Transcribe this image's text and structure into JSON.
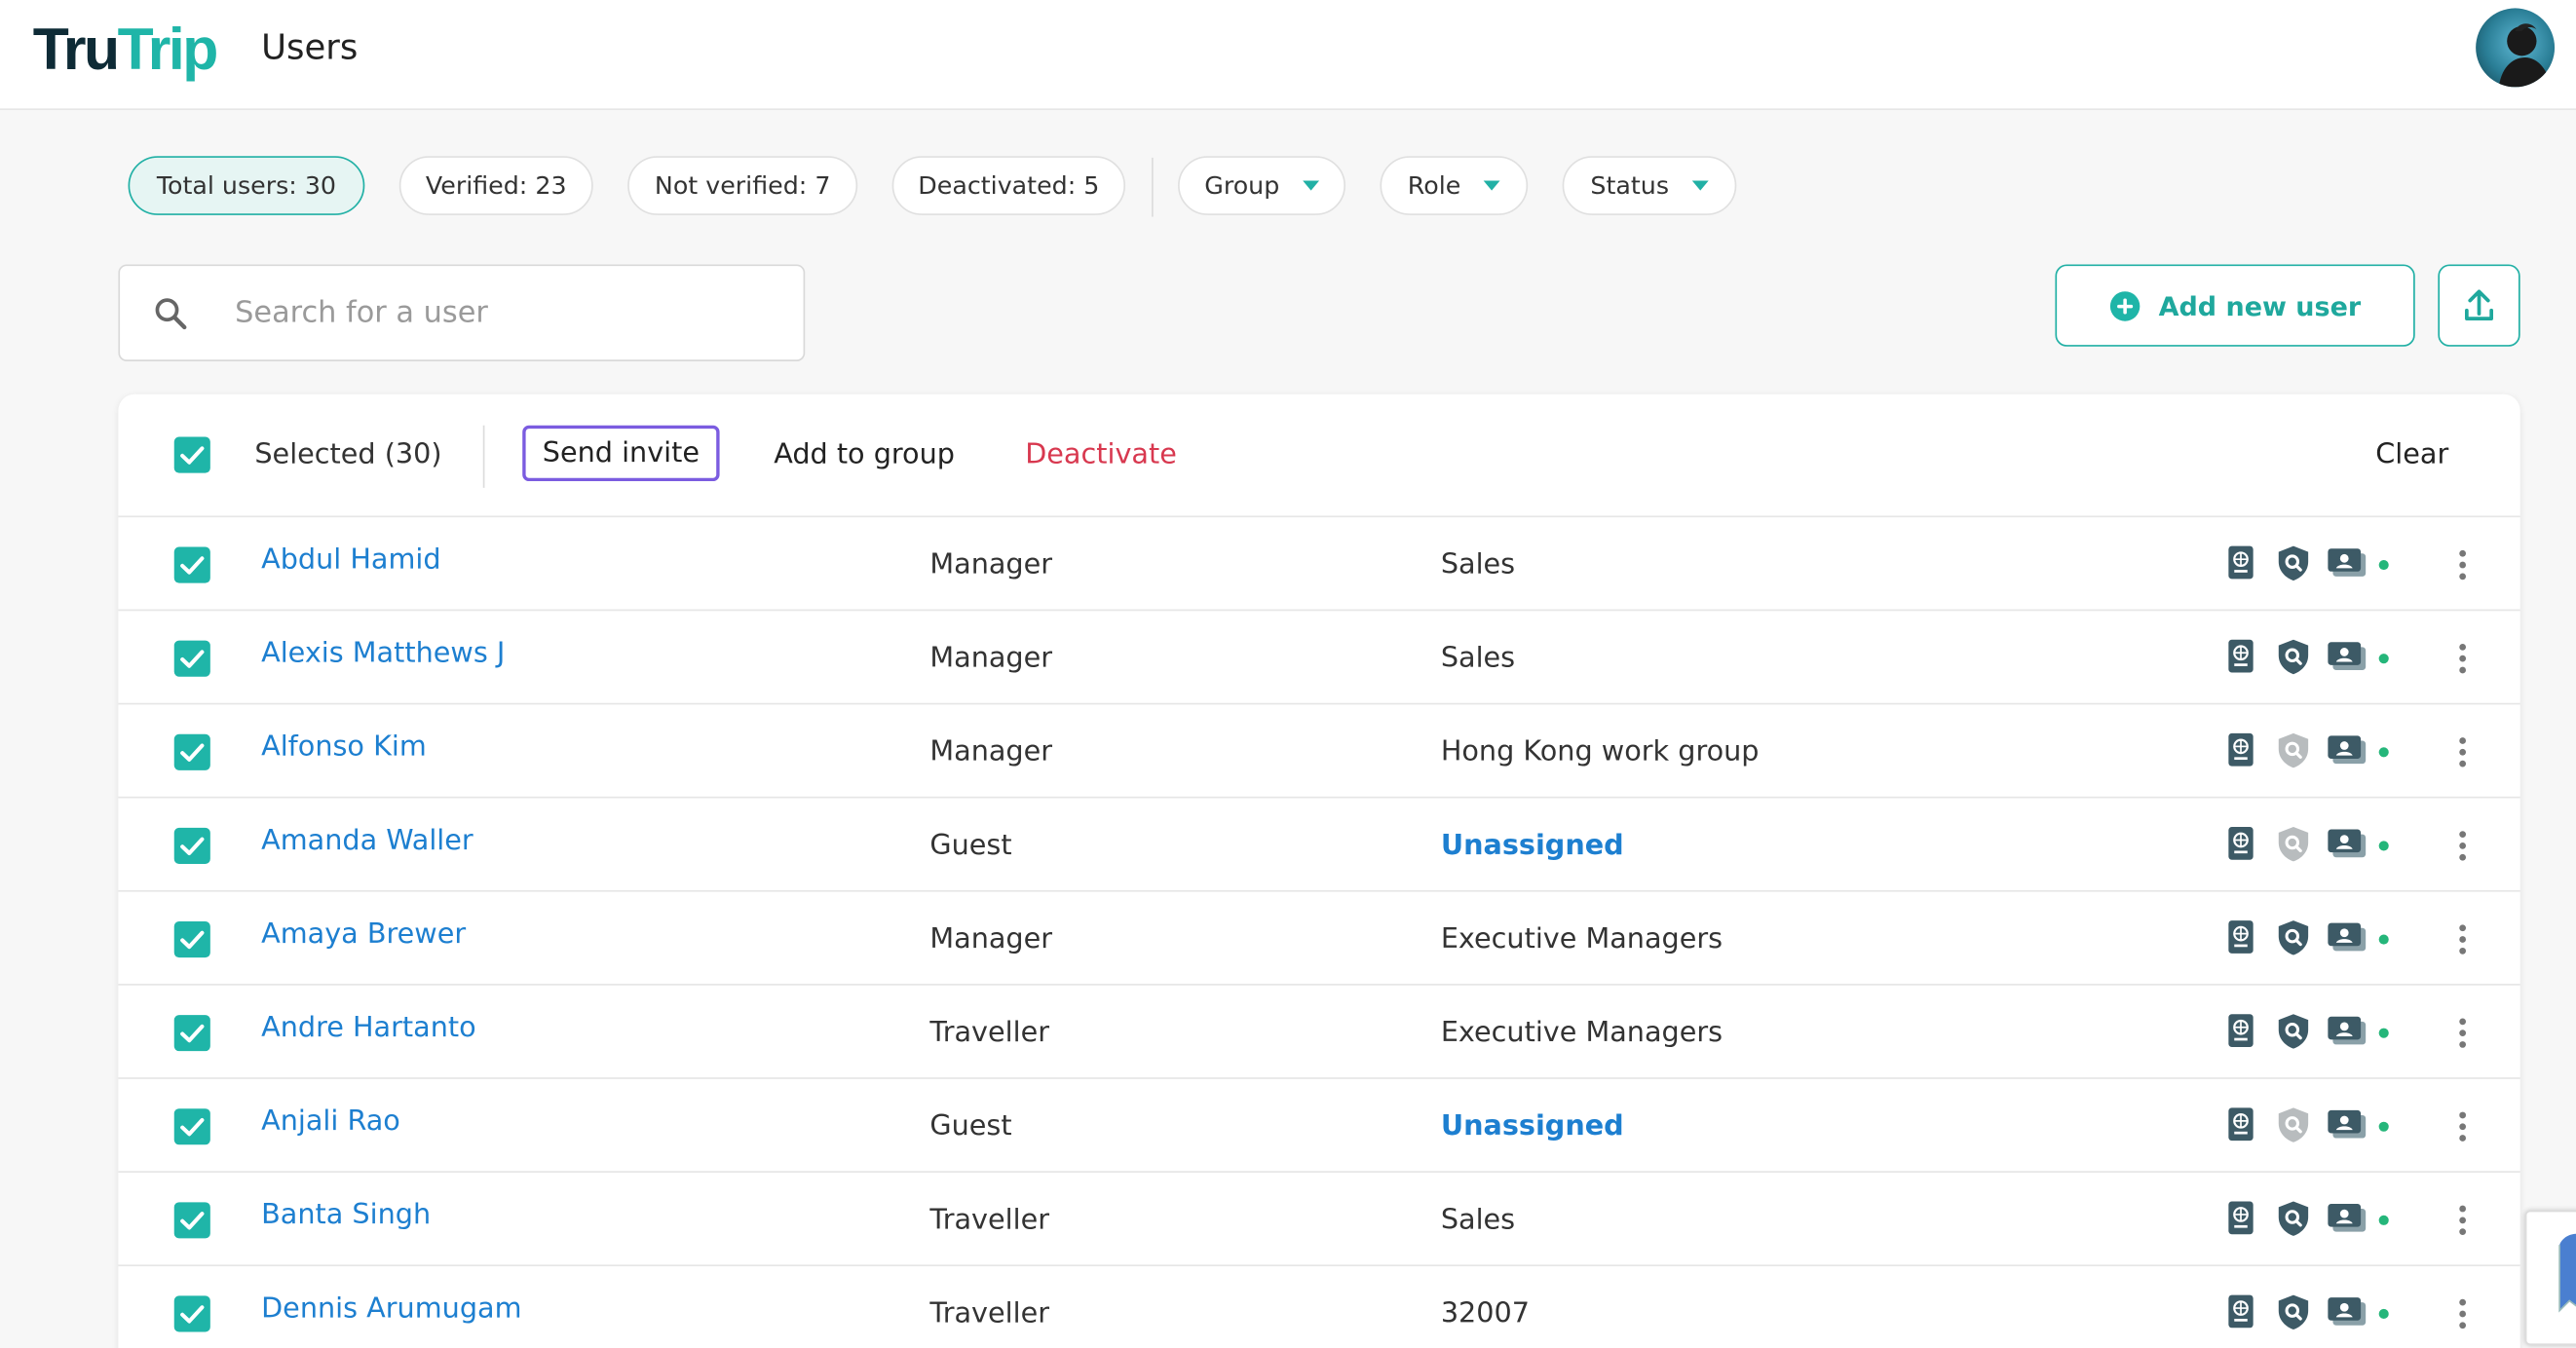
{
  "app": {
    "logo_part1": "Tru",
    "logo_part2": "Trip",
    "page_title": "Users",
    "accent_color": "#1fb5a8",
    "link_color": "#1d7fd0",
    "danger_color": "#d8384f",
    "focus_color": "#7b5ce0"
  },
  "filters": {
    "total": "Total users: 30",
    "verified": "Verified: 23",
    "not_verified": "Not verified: 7",
    "deactivated": "Deactivated: 5",
    "group": "Group",
    "role": "Role",
    "status": "Status"
  },
  "search": {
    "placeholder": "Search for a user",
    "value": ""
  },
  "actions": {
    "add_user": "Add new user"
  },
  "bulk": {
    "selected": "Selected (30)",
    "send_invite": "Send invite",
    "add_to_group": "Add to group",
    "deactivate": "Deactivate",
    "clear": "Clear"
  },
  "users": [
    {
      "name": "Abdul Hamid",
      "role": "Manager",
      "group": "Sales"
    },
    {
      "name": "Alexis Matthews J",
      "role": "Manager",
      "group": "Sales"
    },
    {
      "name": "Alfonso Kim",
      "role": "Manager",
      "group": "Hong Kong work group"
    },
    {
      "name": "Amanda Waller",
      "role": "Guest",
      "group": "Unassigned"
    },
    {
      "name": "Amaya Brewer",
      "role": "Manager",
      "group": "Executive Managers"
    },
    {
      "name": "Andre Hartanto",
      "role": "Traveller",
      "group": "Executive Managers"
    },
    {
      "name": "Anjali Rao",
      "role": "Guest",
      "group": "Unassigned"
    },
    {
      "name": "Banta Singh",
      "role": "Traveller",
      "group": "Sales"
    },
    {
      "name": "Dennis Arumugam",
      "role": "Traveller",
      "group": "32007"
    }
  ]
}
